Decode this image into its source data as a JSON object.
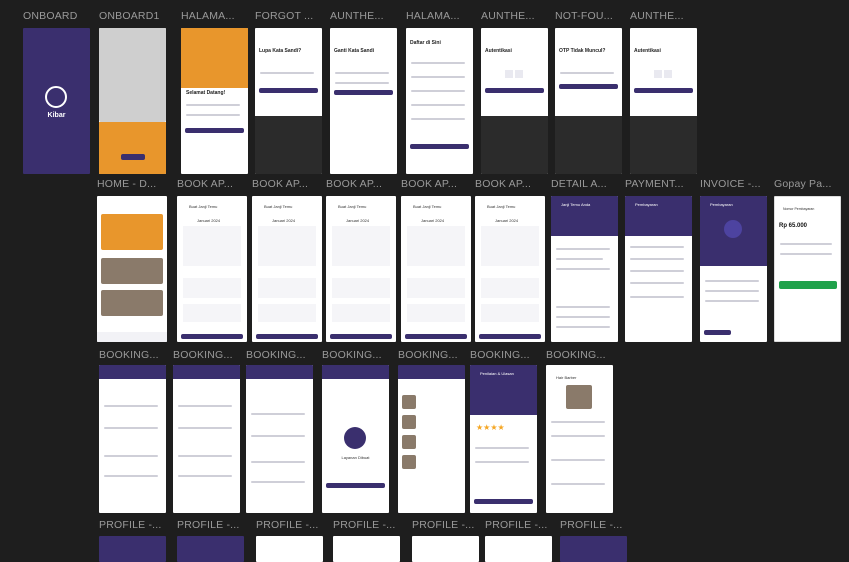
{
  "rows": [
    {
      "labels": [
        "ONBOARD",
        "ONBOARD1",
        "HALAMA...",
        "FORGOT ...",
        "AUNTHE...",
        "HALAMA...",
        "AUNTHE...",
        "NOT-FOU...",
        "AUNTHE..."
      ]
    },
    {
      "labels": [
        "HOME - D...",
        "BOOK AP...",
        "BOOK AP...",
        "BOOK AP...",
        "BOOK AP...",
        "BOOK AP...",
        "DETAIL A...",
        "PAYMENT...",
        "INVOICE -...",
        "Gopay Pa..."
      ]
    },
    {
      "labels": [
        "BOOKING...",
        "BOOKING...",
        "BOOKING...",
        "BOOKING...",
        "BOOKING...",
        "BOOKING...",
        "BOOKING..."
      ]
    },
    {
      "labels": [
        "PROFILE -...",
        "PROFILE -...",
        "PROFILE -...",
        "PROFILE -...",
        "PROFILE -...",
        "PROFILE -...",
        "PROFILE -..."
      ]
    }
  ],
  "screens": {
    "onboard_logo": "Kibar",
    "login_title": "Selamat Datang!",
    "forgot_title": "Lupa Kata Sandi?",
    "reset_title": "Ganti Kata Sandi",
    "register_title": "Daftar di Sini",
    "auth_title": "Autentikasi",
    "otp_title": "OTP Tidak Muncul?",
    "auth_title2": "Autentikasi",
    "gopay_amount": "Rp 65.000",
    "gopay_header": "Nomor Pembayaran",
    "book_header": "Buat Janji Temu",
    "calendar_month": "Januari 2024",
    "detail_header": "Janji Temu Anda",
    "payment_header": "Pembayaran",
    "invoice_header": "Pembayaran",
    "booking_success": "Layanan Dibuat",
    "rating_header": "Penilaian & Ulasan",
    "detail_barber": "Hair Barber"
  }
}
